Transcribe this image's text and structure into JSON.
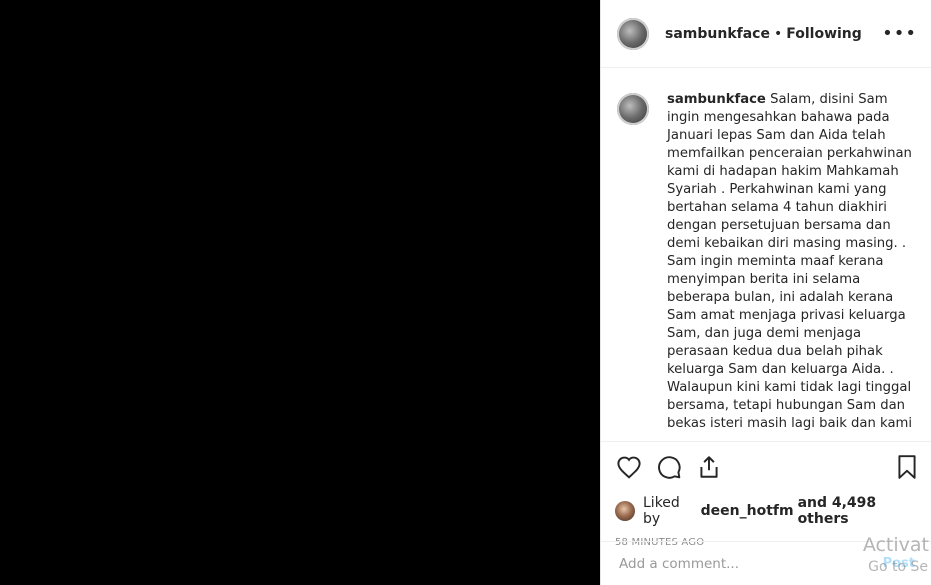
{
  "header": {
    "username": "sambunkface",
    "separator": "•",
    "follow_status": "Following",
    "more_label": "•••"
  },
  "caption": {
    "username": "sambunkface",
    "text": " Salam, disini Sam ingin mengesahkan bahawa pada Januari lepas Sam dan Aida telah memfailkan penceraian perkahwinan kami di hadapan hakim Mahkamah Syariah . Perkahwinan kami yang bertahan selama 4 tahun diakhiri dengan persetujuan bersama dan demi kebaikan diri masing masing. .\nSam ingin meminta maaf kerana menyimpan berita ini selama beberapa bulan, ini adalah kerana Sam amat menjaga privasi keluarga Sam, dan juga demi menjaga perasaan kedua dua belah pihak keluarga Sam dan keluarga Aida. .\nWalaupun kini kami tidak lagi tinggal bersama, tetapi hubungan Sam dan bekas isteri masih lagi baik dan kami"
  },
  "icons": [
    "heart-icon",
    "comment-icon",
    "share-icon",
    "bookmark-icon"
  ],
  "likes": {
    "prefix": "Liked by",
    "user": "deen_hotfm",
    "suffix": "and 4,498 others"
  },
  "timestamp": "58 MINUTES AGO",
  "comment_box": {
    "placeholder": "Add a comment...",
    "post_label": "Post"
  },
  "watermark": {
    "line1": "Activat",
    "line2": "Go to Se"
  }
}
